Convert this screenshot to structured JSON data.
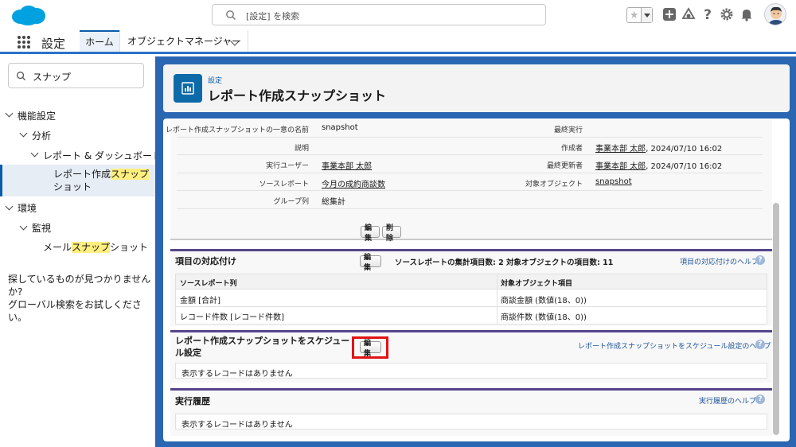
{
  "header": {
    "search_placeholder": "[設定] を検索",
    "icons": [
      "salesforce-logo",
      "search-icon",
      "favorites-star-icon",
      "favorites-dropdown-icon",
      "global-actions-plus-icon",
      "trailhead-icon",
      "help-icon",
      "gear-icon",
      "bell-icon",
      "avatar"
    ]
  },
  "appnav": {
    "app_name": "設定",
    "tabs": [
      {
        "label": "ホーム"
      },
      {
        "label": "オブジェクトマネージャー"
      }
    ]
  },
  "sidebar": {
    "quickfind_value": "スナップ",
    "tree": [
      {
        "label": "機能設定"
      },
      {
        "label": "分析"
      },
      {
        "label": "レポート & ダッシュボード"
      },
      {
        "label_before": "レポート作成",
        "label_hl": "スナップ",
        "label_after": "ショット"
      },
      {
        "label": "環境"
      },
      {
        "label": "監視"
      },
      {
        "label_before": "メール",
        "label_hl": "スナップ",
        "label_after": "ショット"
      }
    ],
    "help_line1": "探しているものが見つかりませんか?",
    "help_line2": "グローバル検索をお試しください。"
  },
  "page": {
    "breadcrumb": "設定",
    "title": "レポート作成スナップショット"
  },
  "detail": {
    "left": [
      {
        "label": "レポート作成スナップショットの一意の名前",
        "value": "snapshot"
      },
      {
        "label": "説明",
        "value": ""
      },
      {
        "label": "実行ユーザー",
        "value": "事業本部 太郎"
      },
      {
        "label": "ソースレポート",
        "value": "今月の成約商談数"
      },
      {
        "label": "グループ列",
        "value": "総集計"
      }
    ],
    "right": [
      {
        "label": "最終実行",
        "value": "",
        "suffix": ""
      },
      {
        "label": "作成者",
        "value": "事業本部 太郎",
        "suffix": ", 2024/07/10 16:02"
      },
      {
        "label": "最終更新者",
        "value": "事業本部 太郎",
        "suffix": ", 2024/07/10 16:02"
      },
      {
        "label": "対象オブジェクト",
        "value": "snapshot",
        "suffix": ""
      }
    ],
    "edit_label": "編集",
    "delete_label": "削除"
  },
  "mapping": {
    "title": "項目の対応付け",
    "edit_label": "編集",
    "source_count_text": "ソースレポートの集計項目数: 2",
    "target_count_text": "対象オブジェクトの項目数: 11",
    "help_link": "項目の対応付けのヘルプ",
    "columns": [
      "ソースレポート列",
      "対象オブジェクト項目"
    ],
    "rows": [
      [
        "金額 [合計]",
        "商談金額 (数値(18、0))"
      ],
      [
        "レコード件数 [レコード件数]",
        "商談件数 (数値(18、0))"
      ]
    ]
  },
  "schedule": {
    "title_line1": "レポート作成スナップショットをスケジュー",
    "title_line2": "ル設定",
    "edit_label": "編集",
    "help_link": "レポート作成スナップショットをスケジュール設定のヘルプ",
    "empty_text": "表示するレコードはありません"
  },
  "history": {
    "title": "実行履歴",
    "help_link": "実行履歴のヘルプ",
    "empty_text": "表示するレコードはありません"
  },
  "help_icon_glyph": "?",
  "colors": {
    "brand_blue": "#0b5cab",
    "content_bg": "#2a66b1",
    "section_border": "#56458c",
    "highlight_box": "#e01414"
  }
}
